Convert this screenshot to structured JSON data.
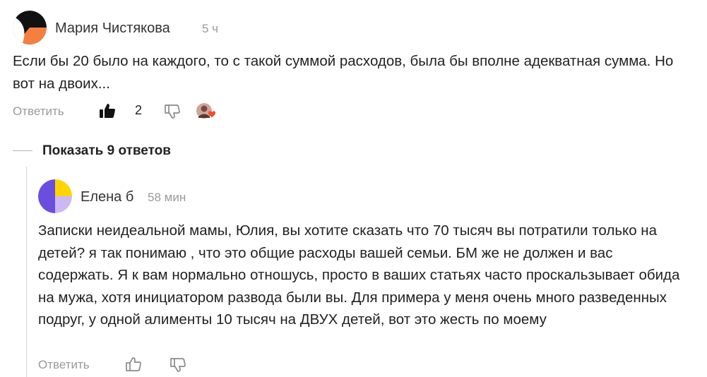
{
  "comment": {
    "author": "Мария Чистякова",
    "time": "5 ч",
    "text": "Если бы 20 было на каждого, то с такой суммой расходов, была бы вполне адекватная сумма. Но вот на двоих...",
    "reply_label": "Ответить",
    "likes": "2",
    "liked": true,
    "avatar_colors": [
      "#111111",
      "#f47f3f"
    ]
  },
  "thread": {
    "show_replies_label": "Показать 9 ответов"
  },
  "reply": {
    "author": "Елена б",
    "time": "58 мин",
    "text": "Записки неидеальной мамы, Юлия, вы хотите сказать что 70 тысяч вы потратили только на детей? я так понимаю , что это общие расходы вашей семьи. БМ же не должен и вас содержать. Я к вам нормально отношусь, просто в ваших статьях часто проскальзывает обида на мужа, хотя инициатором развода были вы. Для примера у меня очень много разведенных подруг, у одной алименты 10 тысяч на ДВУХ детей, вот это жесть по моему",
    "reply_label": "Ответить",
    "avatar_colors": [
      "#6a4ee0",
      "#ffd400",
      "#cdb8f5"
    ]
  },
  "colors": {
    "text": "#222222",
    "muted": "#9a9a9a",
    "reaction_heart": "#f04e2a"
  }
}
